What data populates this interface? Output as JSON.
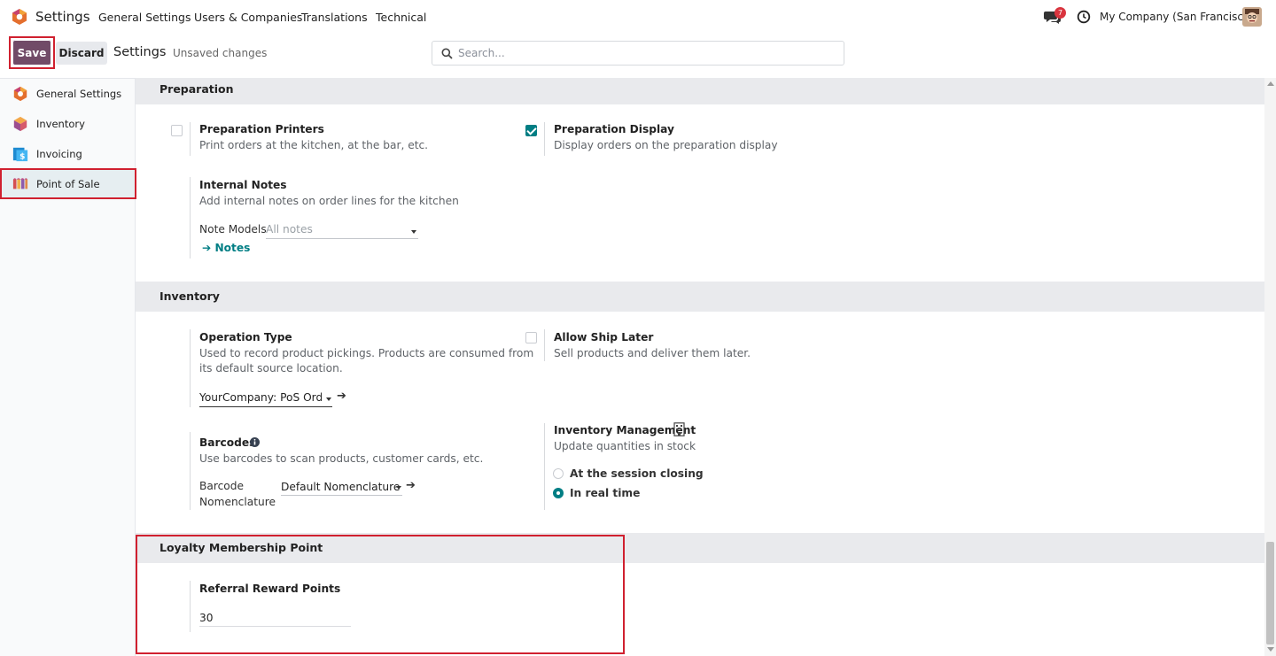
{
  "navbar": {
    "app_name": "Settings",
    "menus": [
      "General Settings",
      "Users & Companies",
      "Translations",
      "Technical"
    ],
    "message_count": "7",
    "company": "My Company (San Francisco)"
  },
  "control": {
    "save": "Save",
    "discard": "Discard",
    "title": "Settings",
    "status": "Unsaved changes",
    "search_placeholder": "Search..."
  },
  "sidebar": {
    "items": [
      {
        "label": "General Settings",
        "icon": "odoo-logo-icon"
      },
      {
        "label": "Inventory",
        "icon": "inventory-cube-icon"
      },
      {
        "label": "Invoicing",
        "icon": "invoicing-icon"
      },
      {
        "label": "Point of Sale",
        "icon": "point-of-sale-icon",
        "active": true
      }
    ]
  },
  "sections": {
    "preparation": {
      "title": "Preparation",
      "printers": {
        "title": "Preparation Printers",
        "desc": "Print orders at the kitchen, at the bar, etc.",
        "checked": false
      },
      "display": {
        "title": "Preparation Display",
        "desc": "Display orders on the preparation display",
        "checked": true
      },
      "notes": {
        "title": "Internal Notes",
        "desc": "Add internal notes on order lines for the kitchen",
        "models_label": "Note Models",
        "models_placeholder": "All notes",
        "link": "Notes"
      }
    },
    "inventory": {
      "title": "Inventory",
      "operation": {
        "title": "Operation Type",
        "desc1": "Used to record product pickings. Products are consumed from",
        "desc2": "its default source location.",
        "value": "YourCompany: PoS Orders"
      },
      "ship_later": {
        "title": "Allow Ship Later",
        "desc": "Sell products and deliver them later.",
        "checked": false
      },
      "barcodes": {
        "title": "Barcodes",
        "desc": "Use barcodes to scan products, customer cards, etc.",
        "label1": "Barcode",
        "label2": "Nomenclature",
        "value": "Default Nomenclature"
      },
      "management": {
        "title": "Inventory Management",
        "desc": "Update quantities in stock",
        "options": [
          "At the session closing",
          "In real time"
        ],
        "selected": "In real time"
      }
    },
    "loyalty": {
      "title": "Loyalty Membership Point",
      "referral": {
        "title": "Referral Reward Points",
        "value": "30"
      }
    }
  },
  "colors": {
    "brand": "#714b67",
    "accent": "#017e84",
    "highlight": "#d0202f"
  }
}
